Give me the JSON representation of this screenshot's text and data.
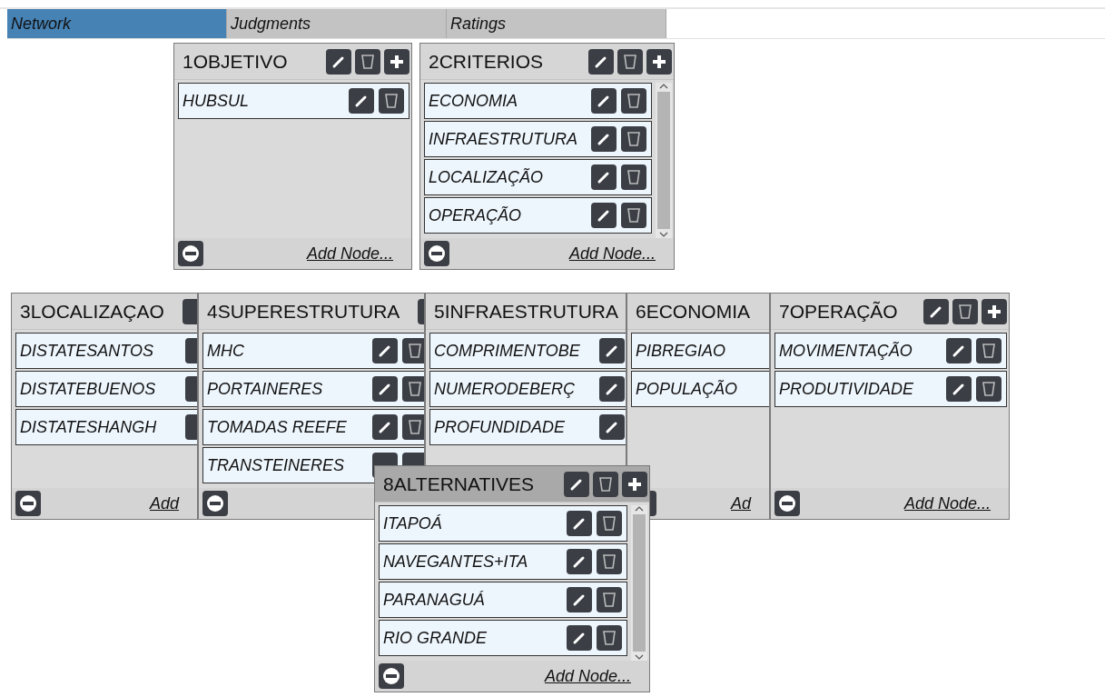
{
  "tabs": [
    {
      "label": "Network",
      "selected": true
    },
    {
      "label": "Judgments",
      "selected": false
    },
    {
      "label": "Ratings",
      "selected": false
    }
  ],
  "clusters": [
    {
      "title": "1OBJETIVO",
      "focused": false,
      "scrollable": false,
      "nodes": [
        "HUBSUL"
      ],
      "add_link": "Add Node..."
    },
    {
      "title": "2CRITERIOS",
      "focused": false,
      "scrollable": true,
      "nodes": [
        "ECONOMIA",
        "INFRAESTRUTURA",
        "LOCALIZAÇÃO",
        "OPERAÇÃO"
      ],
      "add_link": "Add Node..."
    },
    {
      "title": "3LOCALIZAÇAO",
      "focused": false,
      "scrollable": false,
      "nodes": [
        "DISTATESANTOS",
        "DISTATEBUENOS",
        "DISTATESHANGH"
      ],
      "add_link": "Add"
    },
    {
      "title": "4SUPERESTRUTURA",
      "focused": false,
      "scrollable": false,
      "nodes": [
        "MHC",
        "PORTAINERES",
        "TOMADAS REEFE",
        "TRANSTEINERES"
      ]
    },
    {
      "title": "5INFRAESTRUTURA",
      "focused": false,
      "scrollable": false,
      "nodes": [
        "COMPRIMENTOBE",
        "NUMERODEBERÇ",
        "PROFUNDIDADE"
      ]
    },
    {
      "title": "6ECONOMIA",
      "focused": false,
      "scrollable": false,
      "nodes": [
        "PIBREGIAO",
        "POPULAÇÃO"
      ],
      "add_link": "Ad"
    },
    {
      "title": "7OPERAÇÃO",
      "focused": false,
      "scrollable": false,
      "nodes": [
        "MOVIMENTAÇÃO",
        "PRODUTIVIDADE"
      ],
      "add_link": "Add Node..."
    },
    {
      "title": "8ALTERNATIVES",
      "focused": true,
      "scrollable": true,
      "nodes": [
        "ITAPOÁ",
        "NAVEGANTES+ITA",
        "PARANAGUÁ",
        "RIO GRANDE"
      ],
      "add_link": "Add Node..."
    }
  ]
}
